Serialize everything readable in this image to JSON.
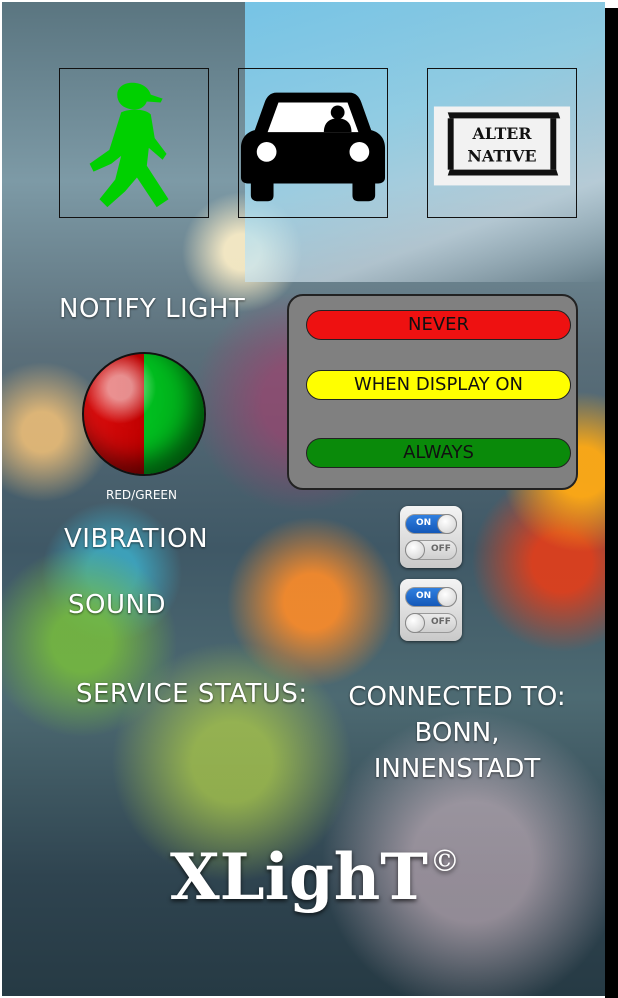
{
  "icons": {
    "pedestrian": "ampelmann-green-icon",
    "car": "car-icon",
    "logo_text_line1": "ALTER",
    "logo_text_line2": "NATIVE"
  },
  "notify_light": {
    "label": "NOTIFY LIGHT",
    "light_caption": "RED/GREEN",
    "options": [
      {
        "label": "NEVER",
        "color": "#ee1111"
      },
      {
        "label": "WHEN DISPLAY ON",
        "color": "#ffff00"
      },
      {
        "label": "ALWAYS",
        "color": "#0a8a0a"
      }
    ]
  },
  "vibration": {
    "label": "VIBRATION",
    "on_label": "ON",
    "off_label": "OFF"
  },
  "sound": {
    "label": "SOUND",
    "on_label": "ON",
    "off_label": "OFF"
  },
  "service": {
    "label": "SERVICE STATUS:",
    "status_line1": "CONNECTED TO:",
    "status_line2": "BONN,",
    "status_line3": "INNENSTADT"
  },
  "brand": {
    "name": "XLighT",
    "mark": "©"
  },
  "colors": {
    "ped_green": "#00d000",
    "light_red": "#e01010",
    "light_green": "#00c020"
  }
}
